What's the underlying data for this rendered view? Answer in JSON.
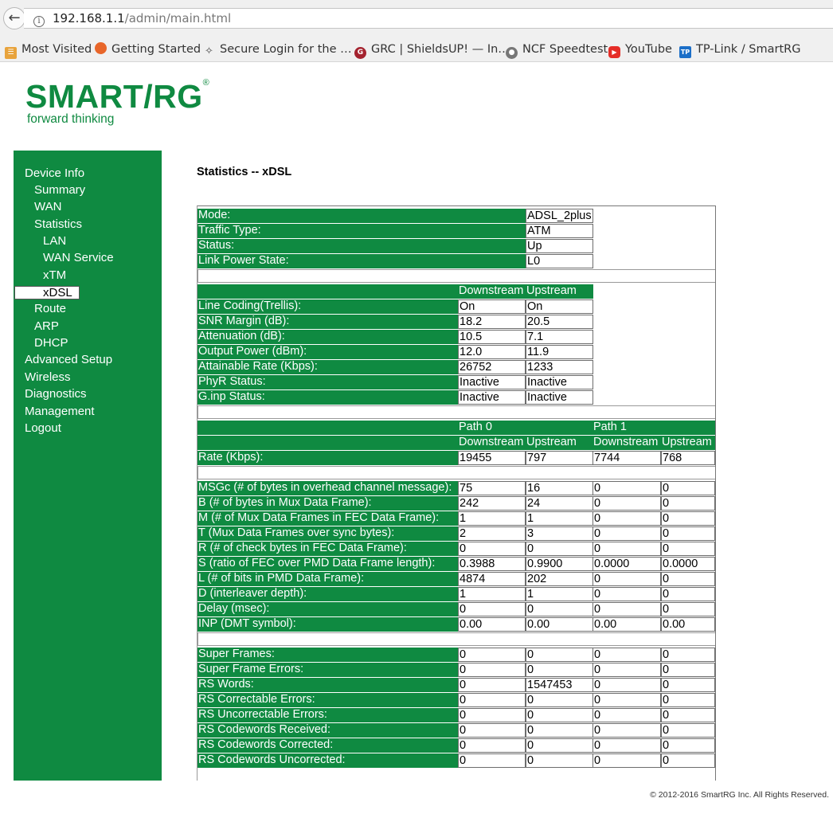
{
  "browser": {
    "url_host": "192.168.1.1",
    "url_path": "/admin/main.html",
    "bookmarks": [
      {
        "label": "Most Visited",
        "icon": "folder-icon"
      },
      {
        "label": "Getting Started",
        "icon": "firefox-icon"
      },
      {
        "label": "Secure Login for the …",
        "icon": "puzzle-icon"
      },
      {
        "label": "GRC | ShieldsUP! — In…",
        "icon": "grc-icon"
      },
      {
        "label": "NCF Speedtest",
        "icon": "globe-icon"
      },
      {
        "label": "YouTube",
        "icon": "youtube-icon"
      },
      {
        "label": "TP-Link / SmartRG",
        "icon": "tplink-icon"
      }
    ]
  },
  "logo": {
    "brand": "SMART/RG",
    "registered": "®",
    "tagline": "forward thinking",
    "color": "#0f8a41"
  },
  "nav": {
    "items": [
      {
        "label": "Device Info",
        "level": 0
      },
      {
        "label": "Summary",
        "level": 1
      },
      {
        "label": "WAN",
        "level": 1
      },
      {
        "label": "Statistics",
        "level": 1
      },
      {
        "label": "LAN",
        "level": 2
      },
      {
        "label": "WAN Service",
        "level": 2
      },
      {
        "label": "xTM",
        "level": 2
      },
      {
        "label": "xDSL",
        "level": 2,
        "active": true
      },
      {
        "label": "Route",
        "level": 1
      },
      {
        "label": "ARP",
        "level": 1
      },
      {
        "label": "DHCP",
        "level": 1
      },
      {
        "label": "Advanced Setup",
        "level": 0
      },
      {
        "label": "Wireless",
        "level": 0
      },
      {
        "label": "Diagnostics",
        "level": 0
      },
      {
        "label": "Management",
        "level": 0
      },
      {
        "label": "Logout",
        "level": 0
      }
    ]
  },
  "page": {
    "title": "Statistics -- xDSL"
  },
  "general": [
    {
      "label": "Mode:",
      "value": "ADSL_2plus"
    },
    {
      "label": "Traffic Type:",
      "value": "ATM"
    },
    {
      "label": "Status:",
      "value": "Up"
    },
    {
      "label": "Link Power State:",
      "value": "L0"
    }
  ],
  "line": {
    "headers": [
      "Downstream",
      "Upstream"
    ],
    "rows": [
      {
        "label": "Line Coding(Trellis):",
        "values": [
          "On",
          "On"
        ]
      },
      {
        "label": "SNR Margin (dB):",
        "values": [
          "18.2",
          "20.5"
        ]
      },
      {
        "label": "Attenuation (dB):",
        "values": [
          "10.5",
          "7.1"
        ]
      },
      {
        "label": "Output Power (dBm):",
        "values": [
          "12.0",
          "11.9"
        ]
      },
      {
        "label": "Attainable Rate (Kbps):",
        "values": [
          "26752",
          "1233"
        ]
      },
      {
        "label": "PhyR Status:",
        "values": [
          "Inactive",
          "Inactive"
        ]
      },
      {
        "label": "G.inp Status:",
        "values": [
          "Inactive",
          "Inactive"
        ]
      }
    ]
  },
  "paths": {
    "path_headers": [
      "Path 0",
      "Path 1"
    ],
    "dir_headers": [
      "Downstream",
      "Upstream",
      "Downstream",
      "Upstream"
    ],
    "rate": {
      "label": "Rate (Kbps):",
      "values": [
        "19455",
        "797",
        "7744",
        "768"
      ]
    },
    "framing": [
      {
        "label": "MSGc (# of bytes in overhead channel message):",
        "values": [
          "75",
          "16",
          "0",
          "0"
        ]
      },
      {
        "label": "B (# of bytes in Mux Data Frame):",
        "values": [
          "242",
          "24",
          "0",
          "0"
        ]
      },
      {
        "label": "M (# of Mux Data Frames in FEC Data Frame):",
        "values": [
          "1",
          "1",
          "0",
          "0"
        ]
      },
      {
        "label": "T (Mux Data Frames over sync bytes):",
        "values": [
          "2",
          "3",
          "0",
          "0"
        ]
      },
      {
        "label": "R (# of check bytes in FEC Data Frame):",
        "values": [
          "0",
          "0",
          "0",
          "0"
        ]
      },
      {
        "label": "S (ratio of FEC over PMD Data Frame length):",
        "values": [
          "0.3988",
          "0.9900",
          "0.0000",
          "0.0000"
        ]
      },
      {
        "label": "L (# of bits in PMD Data Frame):",
        "values": [
          "4874",
          "202",
          "0",
          "0"
        ]
      },
      {
        "label": "D (interleaver depth):",
        "values": [
          "1",
          "1",
          "0",
          "0"
        ]
      },
      {
        "label": "Delay (msec):",
        "values": [
          "0",
          "0",
          "0",
          "0"
        ]
      },
      {
        "label": "INP (DMT symbol):",
        "values": [
          "0.00",
          "0.00",
          "0.00",
          "0.00"
        ]
      }
    ],
    "counters": [
      {
        "label": "Super Frames:",
        "values": [
          "0",
          "0",
          "0",
          "0"
        ]
      },
      {
        "label": "Super Frame Errors:",
        "values": [
          "0",
          "0",
          "0",
          "0"
        ]
      },
      {
        "label": "RS Words:",
        "values": [
          "0",
          "1547453",
          "0",
          "0"
        ]
      },
      {
        "label": "RS Correctable Errors:",
        "values": [
          "0",
          "0",
          "0",
          "0"
        ]
      },
      {
        "label": "RS Uncorrectable Errors:",
        "values": [
          "0",
          "0",
          "0",
          "0"
        ]
      },
      {
        "label": "RS Codewords Received:",
        "values": [
          "0",
          "0",
          "0",
          "0"
        ]
      },
      {
        "label": "RS Codewords Corrected:",
        "values": [
          "0",
          "0",
          "0",
          "0"
        ]
      },
      {
        "label": "RS Codewords Uncorrected:",
        "values": [
          "0",
          "0",
          "0",
          "0"
        ]
      }
    ]
  },
  "footer": {
    "copyright": "© 2012-2016 SmartRG Inc. All Rights Reserved."
  }
}
